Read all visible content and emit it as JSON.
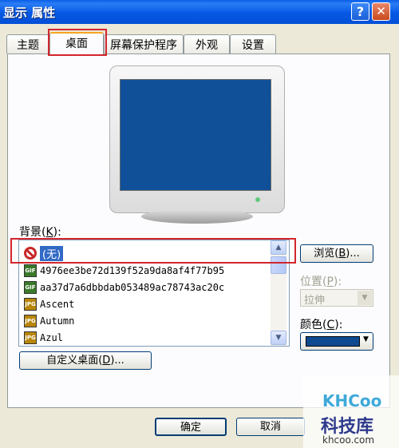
{
  "window": {
    "title": "显示 属性",
    "help_glyph": "?",
    "close_glyph": "✕"
  },
  "tabs": [
    {
      "label": "主题"
    },
    {
      "label": "桌面"
    },
    {
      "label": "屏幕保护程序"
    },
    {
      "label": "外观"
    },
    {
      "label": "设置"
    }
  ],
  "active_tab": "桌面",
  "background": {
    "label": "背景",
    "shortcut": "K",
    "items": [
      {
        "label": "(无)",
        "icon": "none-icon",
        "selected": true
      },
      {
        "label": "4976ee3be72d139f52a9da8af4f77b95",
        "icon": "gif-icon"
      },
      {
        "label": "aa37d7a6dbbdab053489ac78743ac20c",
        "icon": "gif-icon"
      },
      {
        "label": "Ascent",
        "icon": "jpg-icon"
      },
      {
        "label": "Autumn",
        "icon": "jpg-icon"
      },
      {
        "label": "Azul",
        "icon": "jpg-icon"
      }
    ],
    "icon_text": {
      "gif": "GIF",
      "jpg": "JPG"
    }
  },
  "browse": {
    "label": "浏览",
    "shortcut": "B",
    "suffix": "..."
  },
  "position": {
    "label": "位置",
    "shortcut": "P",
    "value": "拉伸"
  },
  "color": {
    "label": "颜色",
    "shortcut": "C",
    "value_hex": "#0f4a91"
  },
  "customize": {
    "label": "自定义桌面",
    "shortcut": "D",
    "suffix": "..."
  },
  "footer": {
    "ok": "确定",
    "cancel": "取消"
  },
  "watermark": {
    "logo": "KHCoo",
    "name": "科技库",
    "url": "khcoo.com"
  },
  "colors": {
    "title_bar": "#0558e4",
    "highlight": "#d2262c",
    "selection": "#316ac5",
    "screen": "#0f5098"
  }
}
